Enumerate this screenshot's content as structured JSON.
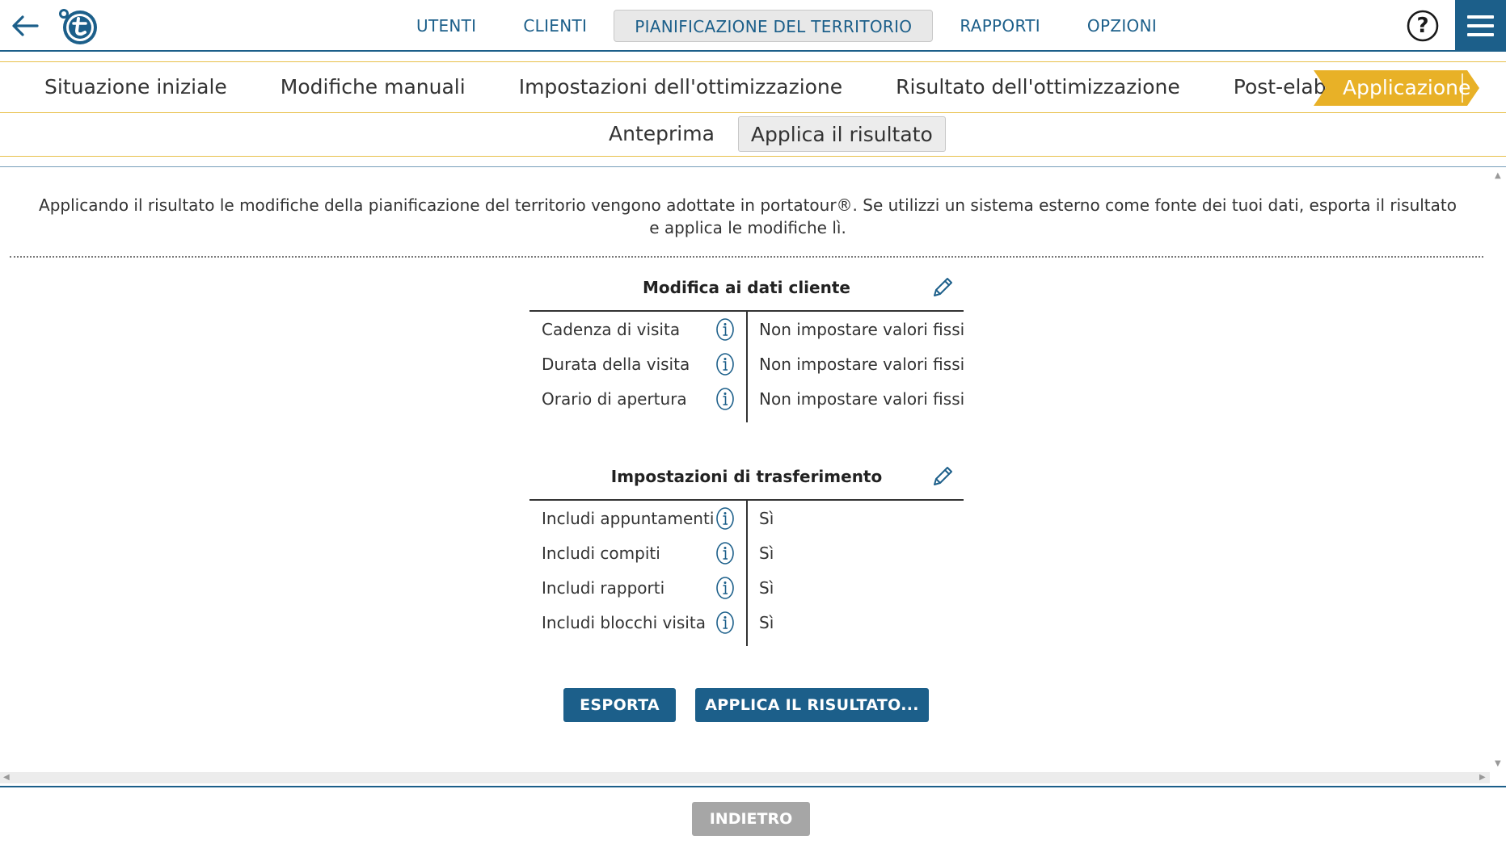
{
  "header": {
    "nav": [
      {
        "label": "UTENTI"
      },
      {
        "label": "CLIENTI"
      },
      {
        "label": "PIANIFICAZIONE DEL TERRITORIO"
      },
      {
        "label": "RAPPORTI"
      },
      {
        "label": "OPZIONI"
      }
    ],
    "help_label": "?"
  },
  "steps": {
    "items": [
      {
        "label": "Situazione iniziale"
      },
      {
        "label": "Modifiche manuali"
      },
      {
        "label": "Impostazioni dell'ottimizzazione"
      },
      {
        "label": "Risultato dell'ottimizzazione"
      },
      {
        "label": "Post-elaborazione"
      }
    ],
    "active": "Applicazione",
    "active_color": "#e8b127"
  },
  "subtabs": {
    "preview": "Anteprima",
    "apply": "Applica il risultato"
  },
  "intro_text": "Applicando il risultato le modifiche della pianificazione del territorio vengono adottate in portatour®. Se utilizzi un sistema esterno come fonte dei tuoi dati, esporta il risultato e applica le modifiche lì.",
  "customer_data": {
    "title": "Modifica ai dati cliente",
    "rows": [
      {
        "label": "Cadenza di visita",
        "value": "Non impostare valori fissi"
      },
      {
        "label": "Durata della visita",
        "value": "Non impostare valori fissi"
      },
      {
        "label": "Orario di apertura",
        "value": "Non impostare valori fissi"
      }
    ]
  },
  "transfer": {
    "title": "Impostazioni di trasferimento",
    "rows": [
      {
        "label": "Includi appuntamenti",
        "value": "Sì"
      },
      {
        "label": "Includi compiti",
        "value": "Sì"
      },
      {
        "label": "Includi rapporti",
        "value": "Sì"
      },
      {
        "label": "Includi blocchi visita",
        "value": "Sì"
      }
    ]
  },
  "actions": {
    "export": "ESPORTA",
    "apply": "APPLICA IL RISULTATO..."
  },
  "footer": {
    "back": "INDIETRO"
  },
  "colors": {
    "primary": "#1c5f8a",
    "accent": "#e8b127",
    "disabled": "#a6a6a6"
  }
}
